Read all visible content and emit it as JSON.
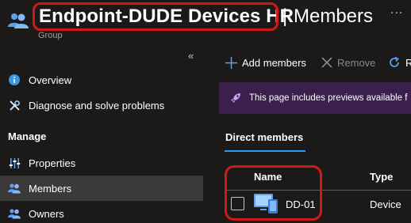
{
  "header": {
    "group_name": "Endpoint-DUDE Devices HR",
    "separator": "|",
    "page_title": "Members",
    "subtitle": "Group",
    "more_label": "..."
  },
  "sidebar": {
    "collapse_label": "«",
    "items": [
      {
        "label": "Overview",
        "icon": "info-icon"
      },
      {
        "label": "Diagnose and solve problems",
        "icon": "wrench-icon"
      }
    ],
    "section_title": "Manage",
    "manage_items": [
      {
        "label": "Properties",
        "icon": "sliders-icon"
      },
      {
        "label": "Members",
        "icon": "people-icon",
        "active": true
      },
      {
        "label": "Owners",
        "icon": "people-icon"
      }
    ]
  },
  "toolbar": {
    "add_label": "Add members",
    "remove_label": "Remove",
    "refresh_label": "R"
  },
  "banner": {
    "text": "This page includes previews available f"
  },
  "tabs": {
    "direct_members": "Direct members"
  },
  "table": {
    "columns": [
      "Name",
      "Type"
    ],
    "rows": [
      {
        "name": "DD-01",
        "type": "Device"
      }
    ]
  },
  "colors": {
    "background": "#1b1a19",
    "active_nav": "#3b3a39",
    "accent": "#2899f5",
    "highlight": "#d01a1a",
    "banner_bg": "#3b1f4d"
  }
}
